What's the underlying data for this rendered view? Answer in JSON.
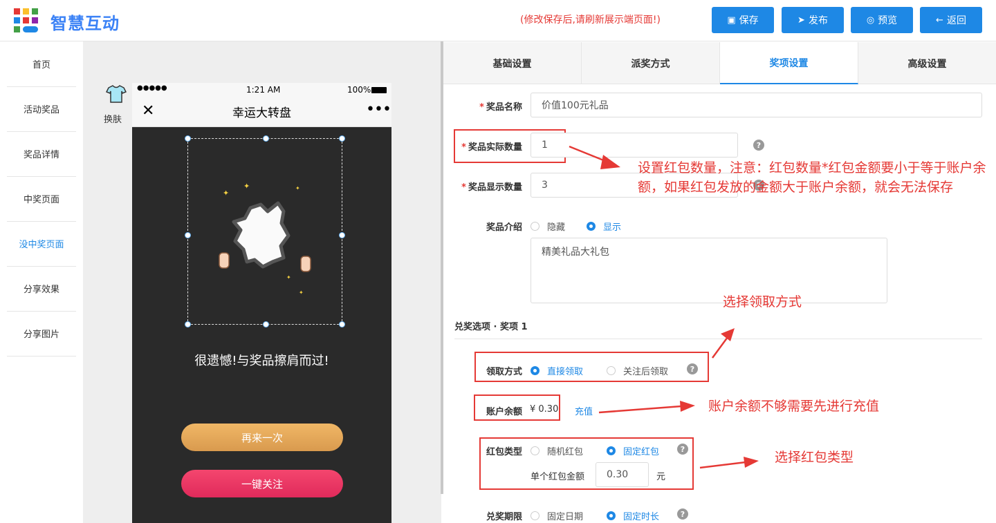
{
  "header": {
    "brand": "智慧互动",
    "notice": "(修改保存后,请刷新展示端页面!)",
    "buttons": [
      {
        "icon": "save-icon",
        "label": "保存"
      },
      {
        "icon": "send-icon",
        "label": "发布"
      },
      {
        "icon": "preview-icon",
        "label": "预览"
      },
      {
        "icon": "back-icon",
        "label": "返回"
      }
    ]
  },
  "nav": [
    "首页",
    "活动奖品",
    "奖品详情",
    "中奖页面",
    "没中奖页面",
    "分享效果",
    "分享图片"
  ],
  "nav_active": "没中奖页面",
  "skin_label": "换肤",
  "phone": {
    "signal": "●●●●●",
    "time": "1:21 AM",
    "battery": "100%",
    "title": "幸运大转盘",
    "message": "很遗憾!与奖品擦肩而过!",
    "retry_button": "再来一次",
    "follow_button": "一键关注"
  },
  "tabs": [
    "基础设置",
    "派奖方式",
    "奖项设置",
    "高级设置"
  ],
  "tab_active": "奖项设置",
  "form": {
    "prize_name": {
      "label": "奖品名称",
      "value": "价值100元礼品"
    },
    "actual_qty": {
      "label": "奖品实际数量",
      "value": "1"
    },
    "display_qty": {
      "label": "奖品显示数量",
      "value": "3"
    },
    "intro": {
      "label": "奖品介绍",
      "options": [
        "隐藏",
        "显示"
      ],
      "selected": "显示",
      "text": "精美礼品大礼包"
    },
    "section_title": "兑奖选项 · 奖项 1",
    "claim_method": {
      "label": "领取方式",
      "options": [
        "直接领取",
        "关注后领取"
      ],
      "selected": "直接领取"
    },
    "balance": {
      "label": "账户余额",
      "value": "¥ 0.30",
      "recharge": "充值"
    },
    "packet_type": {
      "label": "红包类型",
      "options": [
        "随机红包",
        "固定红包"
      ],
      "selected": "固定红包",
      "amount_label": "单个红包金额",
      "amount": "0.30",
      "unit": "元"
    },
    "redeem_period": {
      "label": "兑奖期限",
      "options": [
        "固定日期",
        "固定时长"
      ],
      "selected": "固定时长"
    }
  },
  "annotations": {
    "qty_note": "设置红包数量，注意：红包数量*红包金额要小于等于账户余额，如果红包发放的金额大于账户余额，就会无法保存",
    "claim_note": "选择领取方式",
    "balance_note": "账户余额不够需要先进行充值",
    "type_note": "选择红包类型"
  },
  "colors": {
    "primary": "#1e88e5",
    "annotation": "#e53935",
    "brand": "#3b82f6"
  }
}
